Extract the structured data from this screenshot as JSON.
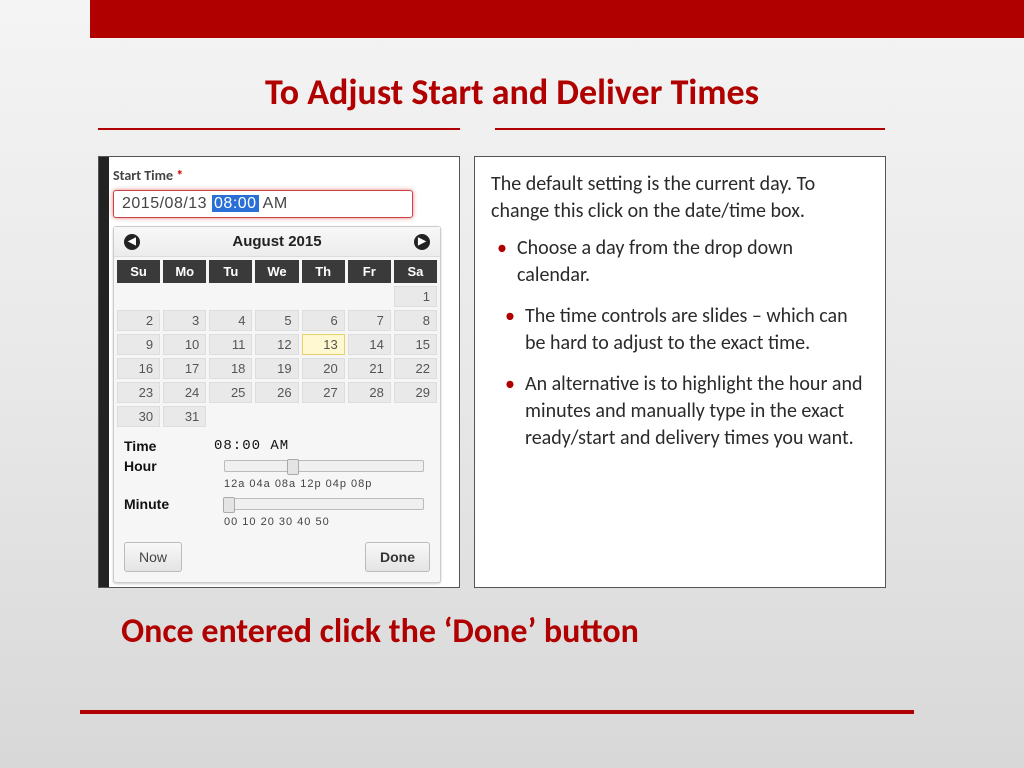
{
  "title": "To Adjust Start and Deliver Times",
  "footer": "Once entered click the ‘Done’ button",
  "panel": {
    "label": "Start Time",
    "req": "*",
    "input": {
      "date": "2015/08/13",
      "time_hl": "08:00",
      "ampm": "AM"
    },
    "calendar": {
      "month": "August 2015",
      "dow": [
        "Su",
        "Mo",
        "Tu",
        "We",
        "Th",
        "Fr",
        "Sa"
      ],
      "weeks": [
        [
          "",
          "",
          "",
          "",
          "",
          "",
          "1"
        ],
        [
          "2",
          "3",
          "4",
          "5",
          "6",
          "7",
          "8"
        ],
        [
          "9",
          "10",
          "11",
          "12",
          "13",
          "14",
          "15"
        ],
        [
          "16",
          "17",
          "18",
          "19",
          "20",
          "21",
          "22"
        ],
        [
          "23",
          "24",
          "25",
          "26",
          "27",
          "28",
          "29"
        ],
        [
          "30",
          "31",
          "",
          "",
          "",
          "",
          ""
        ]
      ],
      "today": "13"
    },
    "time": {
      "label": "Time",
      "value": "08:00 AM",
      "hour_label": "Hour",
      "hour_ticks": "12a 04a 08a 12p 04p 08p",
      "minute_label": "Minute",
      "minute_ticks": "00  10  20  30  40  50"
    },
    "now": "Now",
    "done": "Done"
  },
  "instructions": {
    "intro": "The default setting is the current day. To change this click on the date/time box.",
    "bullets": [
      "Choose a day from the drop down calendar.",
      "The time controls are slides – which can be hard to adjust to the exact time.",
      "An alternative is to highlight the hour and minutes and manually type in the exact ready/start and delivery times you want."
    ]
  }
}
